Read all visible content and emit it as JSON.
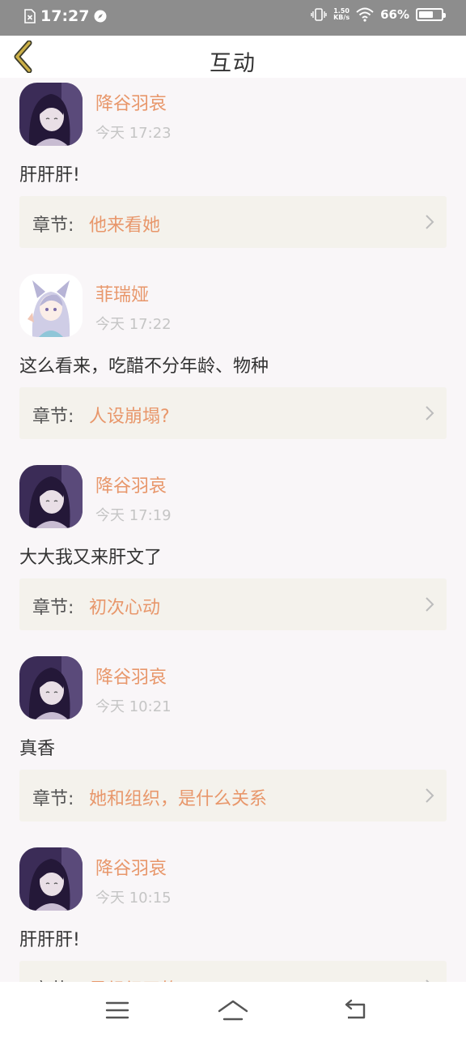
{
  "status_bar": {
    "time": "17:27",
    "net_speed_value": "1.50",
    "net_speed_unit": "KB/s",
    "battery_percent": "66%",
    "battery_level": 0.66
  },
  "header": {
    "title": "互动"
  },
  "comments": [
    {
      "user": "降谷羽哀",
      "time": "今天 17:23",
      "text": "肝肝肝!",
      "chapter_label": "章节:",
      "chapter_title": "他来看她",
      "avatar": "dark-hair-girl"
    },
    {
      "user": "菲瑞娅",
      "time": "今天 17:22",
      "text": "这么看来，吃醋不分年龄、物种",
      "chapter_label": "章节:",
      "chapter_title": "人设崩塌?",
      "avatar": "fox-ear-girl"
    },
    {
      "user": "降谷羽哀",
      "time": "今天 17:19",
      "text": "大大我又来肝文了",
      "chapter_label": "章节:",
      "chapter_title": "初次心动",
      "avatar": "dark-hair-girl"
    },
    {
      "user": "降谷羽哀",
      "time": "今天 10:21",
      "text": "真香",
      "chapter_label": "章节:",
      "chapter_title": "她和组织，是什么关系",
      "avatar": "dark-hair-girl"
    },
    {
      "user": "降谷羽哀",
      "time": "今天 10:15",
      "text": "肝肝肝!",
      "chapter_label": "章节:",
      "chapter_title": "是组织干的?",
      "avatar": "dark-hair-girl"
    }
  ],
  "bottom_nav": {
    "icons": [
      "menu-icon",
      "home-icon",
      "back-icon"
    ]
  },
  "colors": {
    "accent": "#e8976b",
    "back_arrow": "#ccb048",
    "status_bar": "#8d8d8d"
  }
}
